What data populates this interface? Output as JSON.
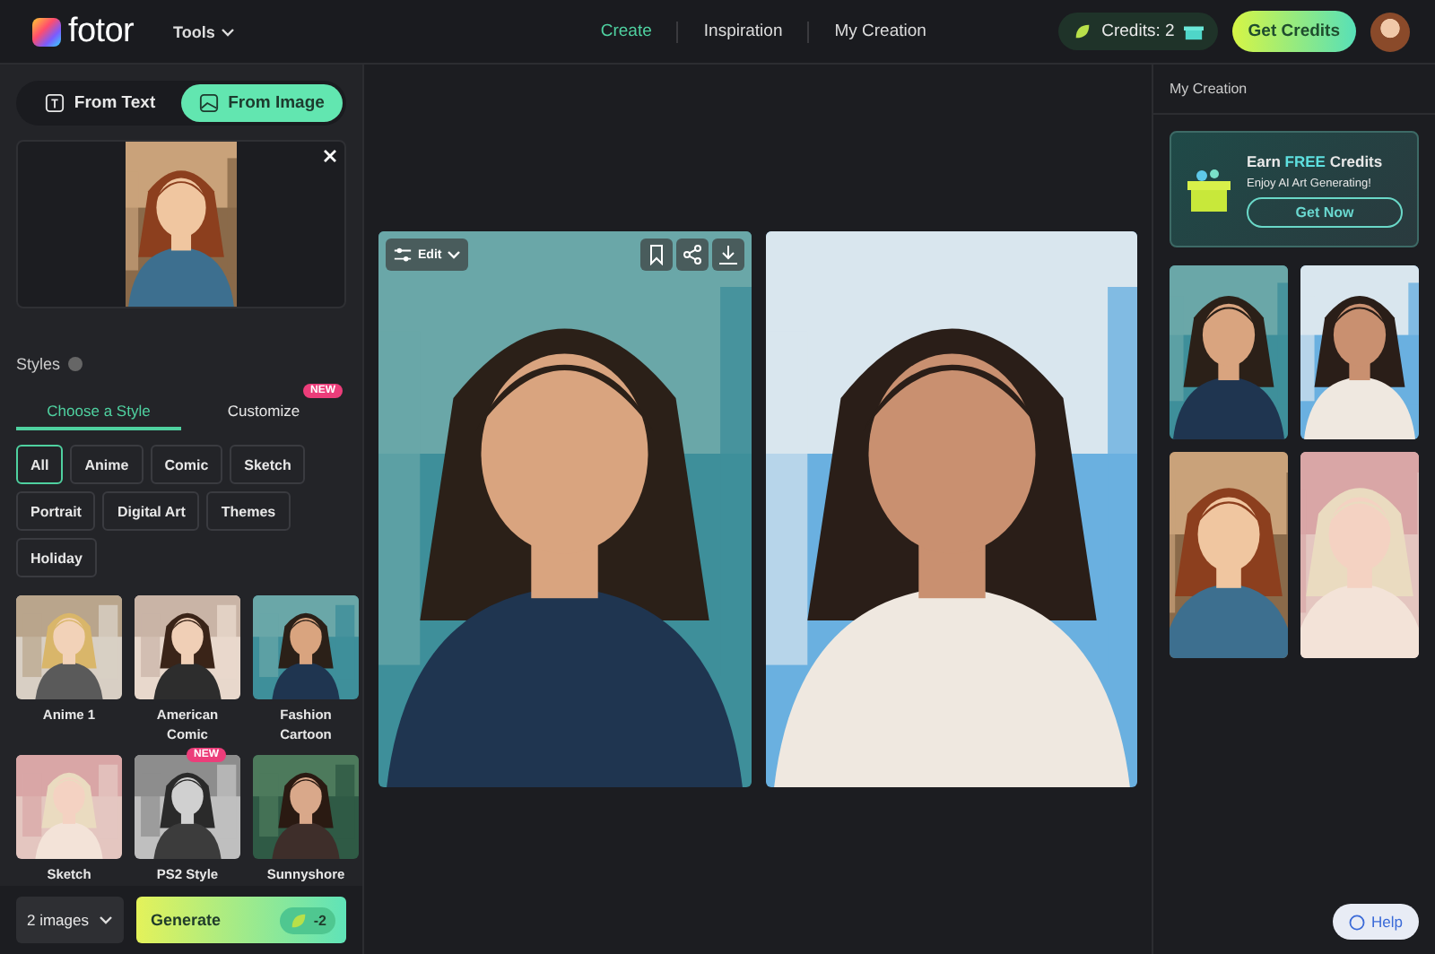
{
  "header": {
    "logo": "fotor",
    "tools": "Tools",
    "nav": [
      {
        "label": "Create",
        "selected": true
      },
      {
        "label": "Inspiration",
        "selected": false
      },
      {
        "label": "My Creation",
        "selected": false
      }
    ],
    "credits": "Credits: 2",
    "get_credits": "Get Credits"
  },
  "left": {
    "mode_tabs": [
      {
        "label": "From Text",
        "selected": false
      },
      {
        "label": "From Image",
        "selected": true
      }
    ],
    "styles_title": "Styles",
    "style_tabs": [
      {
        "label": "Choose a Style",
        "selected": true
      },
      {
        "label": "Customize",
        "selected": false,
        "badge": "NEW"
      }
    ],
    "categories": [
      {
        "label": "All",
        "selected": true
      },
      {
        "label": "Anime",
        "selected": false
      },
      {
        "label": "Comic",
        "selected": false
      },
      {
        "label": "Sketch",
        "selected": false
      },
      {
        "label": "Portrait",
        "selected": false
      },
      {
        "label": "Digital Art",
        "selected": false
      },
      {
        "label": "Themes",
        "selected": false
      },
      {
        "label": "Holiday",
        "selected": false
      }
    ],
    "style_cards": [
      {
        "label": "Anime 1"
      },
      {
        "label": "American Comic"
      },
      {
        "label": "Fashion Cartoon"
      },
      {
        "label": "Sketch"
      },
      {
        "label": "PS2 Style",
        "badge": "NEW"
      },
      {
        "label": "Sunnyshore"
      }
    ],
    "count": "2 images",
    "generate": "Generate",
    "cost": "-2"
  },
  "center": {
    "edit": "Edit"
  },
  "right": {
    "title": "My Creation",
    "promo": {
      "before": "Earn",
      "highlight": "FREE",
      "after": "Credits",
      "subtitle": "Enjoy AI Art Generating!",
      "button": "Get Now"
    }
  },
  "help": "Help"
}
